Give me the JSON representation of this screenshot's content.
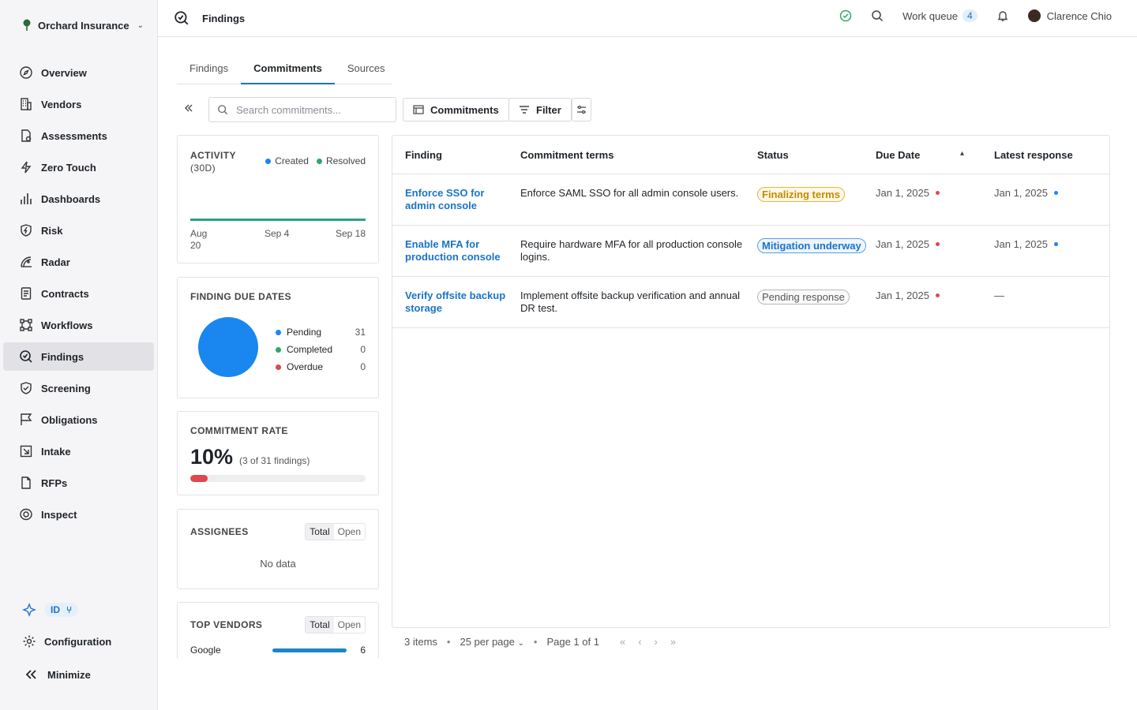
{
  "org": {
    "name": "Orchard Insurance"
  },
  "nav": {
    "items": [
      {
        "label": "Overview",
        "icon": "compass-icon"
      },
      {
        "label": "Vendors",
        "icon": "building-icon"
      },
      {
        "label": "Assessments",
        "icon": "document-check-icon"
      },
      {
        "label": "Zero Touch",
        "icon": "lightning-icon"
      },
      {
        "label": "Dashboards",
        "icon": "bar-chart-icon"
      },
      {
        "label": "Risk",
        "icon": "shield-bolt-icon"
      },
      {
        "label": "Radar",
        "icon": "radar-icon"
      },
      {
        "label": "Contracts",
        "icon": "contract-icon"
      },
      {
        "label": "Workflows",
        "icon": "workflow-icon"
      },
      {
        "label": "Findings",
        "icon": "findings-icon",
        "active": true
      },
      {
        "label": "Screening",
        "icon": "shield-check-icon"
      },
      {
        "label": "Obligations",
        "icon": "flag-icon"
      },
      {
        "label": "Intake",
        "icon": "intake-icon"
      },
      {
        "label": "RFPs",
        "icon": "rfp-icon"
      },
      {
        "label": "Inspect",
        "icon": "eye-icon"
      }
    ],
    "id_badge": "ID",
    "configuration": "Configuration",
    "minimize": "Minimize"
  },
  "topbar": {
    "title": "Findings",
    "work_queue_label": "Work queue",
    "work_queue_count": "4",
    "user_name": "Clarence Chio"
  },
  "tabs": [
    "Findings",
    "Commitments",
    "Sources"
  ],
  "toolbar": {
    "search_placeholder": "Search commitments...",
    "view_label": "Commitments",
    "filter_label": "Filter"
  },
  "activity": {
    "title_line1": "ACTIVITY",
    "title_line2": "(30D)",
    "legend_created": "Created",
    "legend_resolved": "Resolved",
    "x_tick_1a": "Aug",
    "x_tick_1b": "20",
    "x_tick_2": "Sep 4",
    "x_tick_3": "Sep 18"
  },
  "due_dates": {
    "title": "FINDING DUE DATES",
    "rows": [
      {
        "label": "Pending",
        "value": "31",
        "color": "#1a86f0"
      },
      {
        "label": "Completed",
        "value": "0",
        "color": "#2ea56b"
      },
      {
        "label": "Overdue",
        "value": "0",
        "color": "#e0474c"
      }
    ]
  },
  "commitment_rate": {
    "title": "COMMITMENT RATE",
    "value": "10%",
    "detail": "(3 of 31 findings)",
    "fraction": 0.1
  },
  "assignees": {
    "title": "ASSIGNEES",
    "seg_total": "Total",
    "seg_open": "Open",
    "empty": "No data"
  },
  "top_vendors": {
    "title": "TOP VENDORS",
    "seg_total": "Total",
    "seg_open": "Open",
    "vendor_name": "Google",
    "vendor_value": "6"
  },
  "table": {
    "headers": [
      "Finding",
      "Commitment terms",
      "Status",
      "Due Date",
      "Latest response"
    ],
    "rows": [
      {
        "finding": "Enforce SSO for admin console",
        "terms": "Enforce SAML SSO for all admin console users.",
        "status": "Finalizing terms",
        "status_color": "#c58a00",
        "due": "Jan 1, 2025",
        "latest": "Jan 1, 2025"
      },
      {
        "finding": "Enable MFA for production console",
        "terms": "Require hardware MFA for all production console logins.",
        "status": "Mitigation underway",
        "status_color": "#1a73c8",
        "due": "Jan 1, 2025",
        "latest": "Jan 1, 2025"
      },
      {
        "finding": "Verify offsite backup storage",
        "terms": "Implement offsite backup verification and annual DR test.",
        "status": "Pending response",
        "status_color": "#666666",
        "due": "Jan 1, 2025",
        "latest": "—"
      }
    ]
  },
  "pager": {
    "items": "3 items",
    "per_page": "25 per page",
    "page": "Page 1 of 1"
  }
}
